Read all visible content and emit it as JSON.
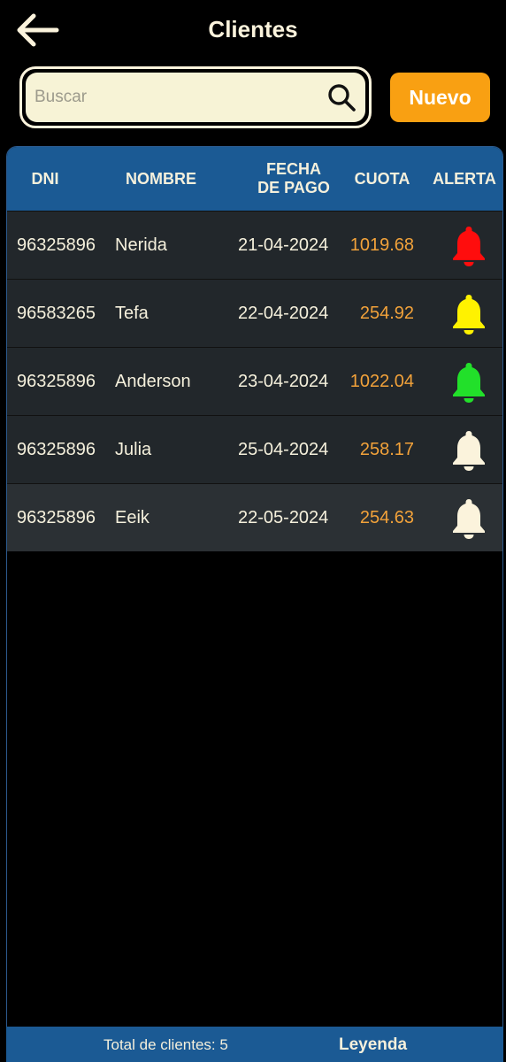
{
  "header": {
    "title": "Clientes",
    "back_icon": "arrow-left-icon"
  },
  "search": {
    "placeholder": "Buscar",
    "value": "",
    "icon": "search-icon"
  },
  "new_button": {
    "label": "Nuevo",
    "color": "#f9a012"
  },
  "table": {
    "columns": {
      "dni": "DNI",
      "nombre": "NOMBRE",
      "fecha_line1": "FECHA",
      "fecha_line2": "DE PAGO",
      "cuota": "CUOTA",
      "alerta": "ALERTA"
    },
    "header_color": "#1b5a94",
    "rows": [
      {
        "dni": "96325896",
        "nombre": "Nerida",
        "fecha": "21-04-2024",
        "cuota": "1019.68",
        "alert_color": "#ff0d0d"
      },
      {
        "dni": "96583265",
        "nombre": "Tefa",
        "fecha": "22-04-2024",
        "cuota": "254.92",
        "alert_color": "#fff200"
      },
      {
        "dni": "96325896",
        "nombre": "Anderson",
        "fecha": "23-04-2024",
        "cuota": "1022.04",
        "alert_color": "#22e02a"
      },
      {
        "dni": "96325896",
        "nombre": "Julia",
        "fecha": "25-04-2024",
        "cuota": "258.17",
        "alert_color": "#fbf3dc"
      },
      {
        "dni": "96325896",
        "nombre": "Eeik",
        "fecha": "22-05-2024",
        "cuota": "254.63",
        "alert_color": "#fbf3dc"
      }
    ]
  },
  "footer": {
    "total_label": "Total de clientes: 5",
    "legend_label": "Leyenda"
  }
}
